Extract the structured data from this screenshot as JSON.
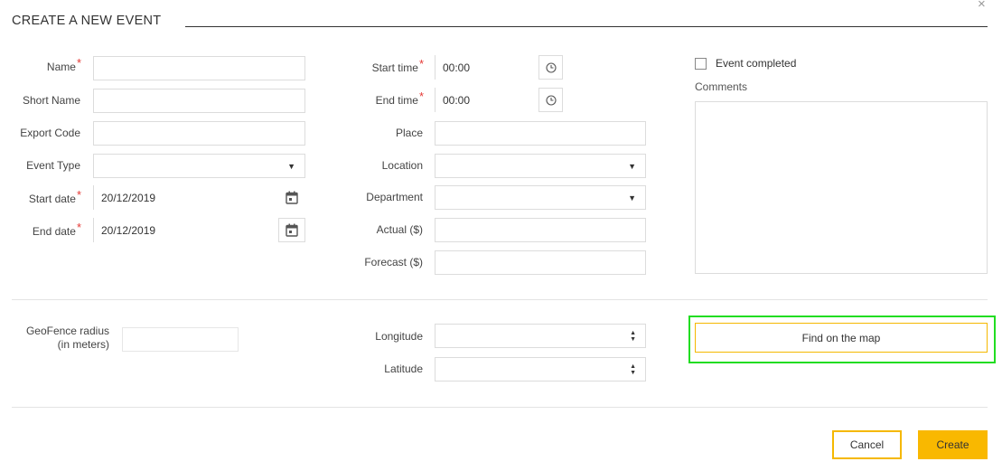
{
  "dialog": {
    "title": "CREATE A NEW EVENT",
    "close_glyph": "×"
  },
  "left": {
    "name_label": "Name",
    "short_name_label": "Short Name",
    "export_code_label": "Export Code",
    "event_type_label": "Event Type",
    "start_date_label": "Start date",
    "start_date_value": "20/12/2019",
    "end_date_label": "End date",
    "end_date_value": "20/12/2019",
    "required_marker": "*"
  },
  "middle": {
    "start_time_label": "Start time",
    "start_time_value": "00:00",
    "end_time_label": "End time",
    "end_time_value": "00:00",
    "place_label": "Place",
    "location_label": "Location",
    "department_label": "Department",
    "actual_label": "Actual ($)",
    "forecast_label": "Forecast ($)"
  },
  "right": {
    "event_completed_label": "Event completed",
    "comments_label": "Comments"
  },
  "geo": {
    "radius_label_line1": "GeoFence radius",
    "radius_label_line2": "(in meters)",
    "longitude_label": "Longitude",
    "latitude_label": "Latitude",
    "find_map_label": "Find on the map"
  },
  "footer": {
    "cancel_label": "Cancel",
    "create_label": "Create"
  },
  "icons": {
    "dropdown": "chevron-down-icon",
    "calendar": "calendar-icon",
    "clock": "clock-icon",
    "spinner": "spinner-icon",
    "close": "close-icon"
  },
  "colors": {
    "accent": "#f9b800",
    "required": "#e53935",
    "highlight": "#22dd22"
  }
}
